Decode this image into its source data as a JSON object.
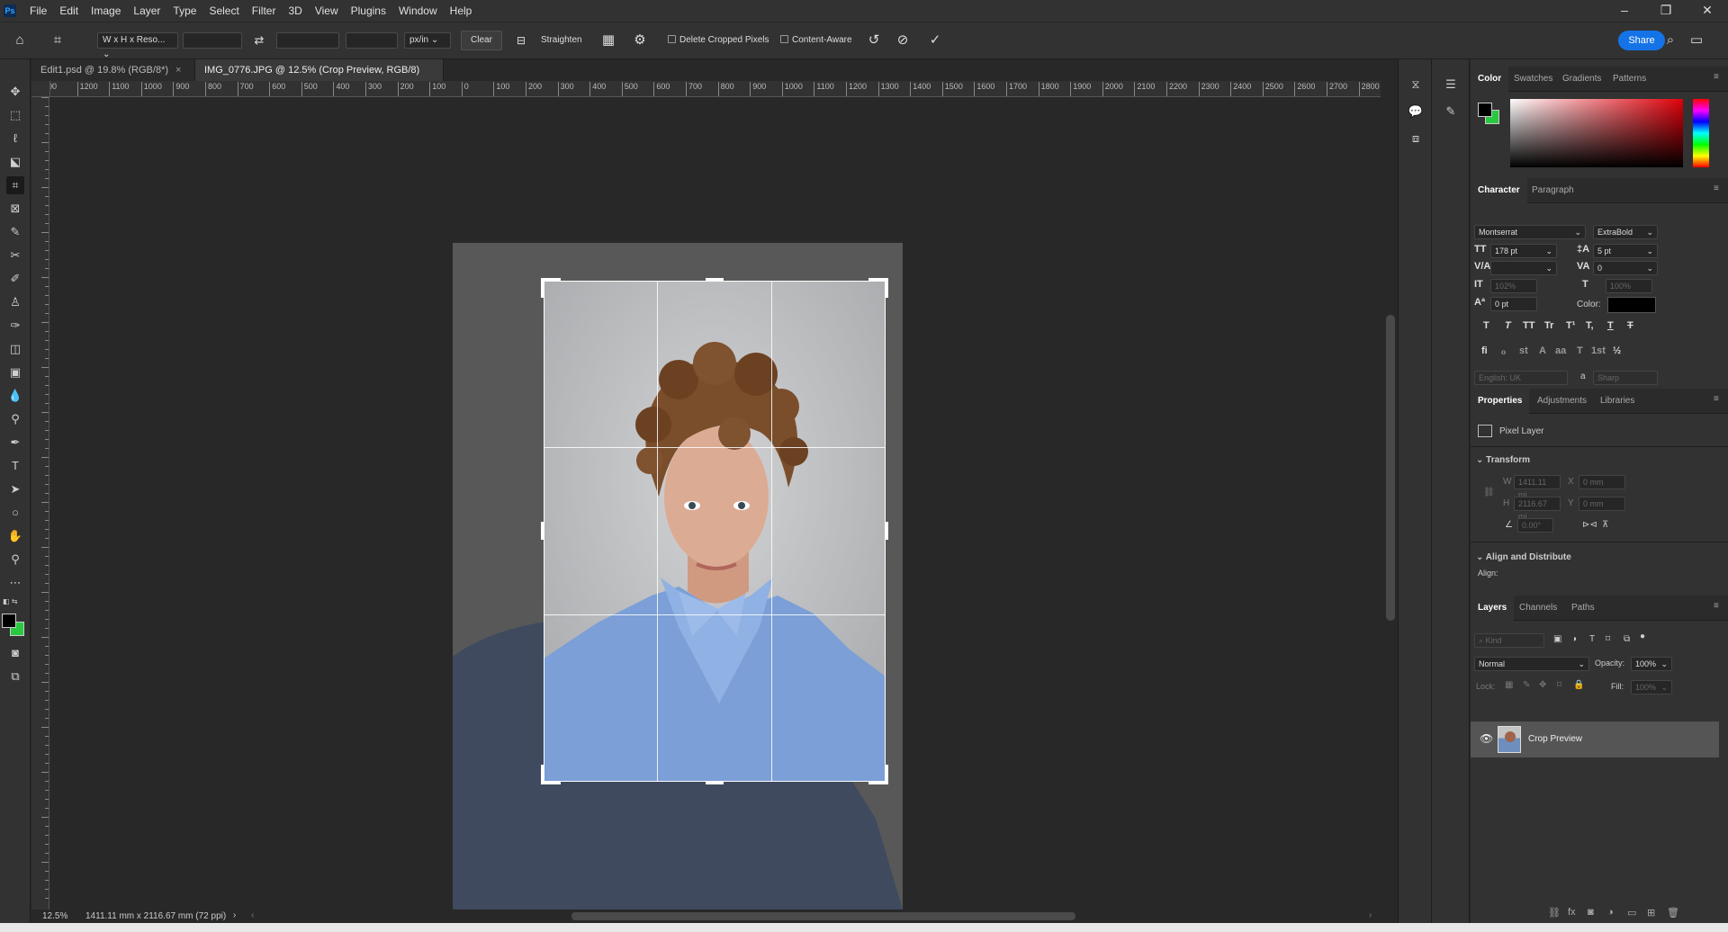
{
  "menubar": {
    "logo": "Ps",
    "items": [
      "File",
      "Edit",
      "Image",
      "Layer",
      "Type",
      "Select",
      "Filter",
      "3D",
      "View",
      "Plugins",
      "Window",
      "Help"
    ]
  },
  "options": {
    "ratio_select": "W x H x Reso...",
    "unit_select": "px/in",
    "clear_label": "Clear",
    "straighten_label": "Straighten",
    "delete_cropped_label": "Delete Cropped Pixels",
    "content_aware_label": "Content-Aware",
    "share_label": "Share"
  },
  "tabs": [
    {
      "label": "Edit1.psd @ 19.8% (RGB/8*)"
    },
    {
      "label": "IMG_0776.JPG @ 12.5% (Crop Preview, RGB/8) *"
    }
  ],
  "ruler": {
    "top_labels": [
      "00",
      "1200",
      "1100",
      "1000",
      "900",
      "800",
      "700",
      "600",
      "500",
      "400",
      "300",
      "200",
      "100",
      "0",
      "100",
      "200",
      "300",
      "400",
      "500",
      "600",
      "700",
      "800",
      "900",
      "1000",
      "1100",
      "1200",
      "1300",
      "1400",
      "1500",
      "1600",
      "1700",
      "1800",
      "1900",
      "2000",
      "2100",
      "2200",
      "2300",
      "2400",
      "2500",
      "2600",
      "2700",
      "2800",
      "2"
    ]
  },
  "status": {
    "zoom": "12.5%",
    "doc_size": "1411.11 mm x 2116.67 mm (72 ppi)"
  },
  "color_panel": {
    "tabs": [
      "Color",
      "Swatches",
      "Gradients",
      "Patterns"
    ],
    "foreground": "#000000",
    "background": "#28c840"
  },
  "character_panel": {
    "tabs": [
      "Character",
      "Paragraph"
    ],
    "font_family": "Montserrat",
    "font_style": "ExtraBold",
    "font_size": "178 pt",
    "leading": "5 pt",
    "kerning": "",
    "tracking": "0",
    "vertical_scale": "102%",
    "horizontal_scale": "100%",
    "baseline_shift": "0 pt",
    "color_label": "Color:",
    "style_buttons": [
      "T",
      "T",
      "TT",
      "Tr",
      "T¹",
      "T,",
      "T",
      "T"
    ],
    "opentype_buttons": [
      "fi",
      "ℴ",
      "st",
      "A",
      "aa",
      "T",
      "1st",
      "½"
    ],
    "language": "English: UK",
    "antialias_label": "a",
    "antialias": "Sharp"
  },
  "properties_panel": {
    "tabs": [
      "Properties",
      "Adjustments",
      "Libraries"
    ],
    "layer_type": "Pixel Layer",
    "transform_title": "Transform",
    "w_label": "W",
    "w_value": "1411.11 mi",
    "h_label": "H",
    "h_value": "2116.67 mi",
    "x_label": "X",
    "x_value": "0 mm",
    "y_label": "Y",
    "y_value": "0 mm",
    "angle_value": "0.00°",
    "align_title": "Align and Distribute",
    "align_label": "Align:"
  },
  "layers_panel": {
    "tabs": [
      "Layers",
      "Channels",
      "Paths"
    ],
    "kind_placeholder": "Kind",
    "blend_mode": "Normal",
    "opacity_label": "Opacity:",
    "opacity": "100%",
    "lock_label": "Lock:",
    "fill_label": "Fill:",
    "fill": "100%",
    "layers": [
      {
        "name": "Crop Preview",
        "visible": true
      }
    ]
  }
}
